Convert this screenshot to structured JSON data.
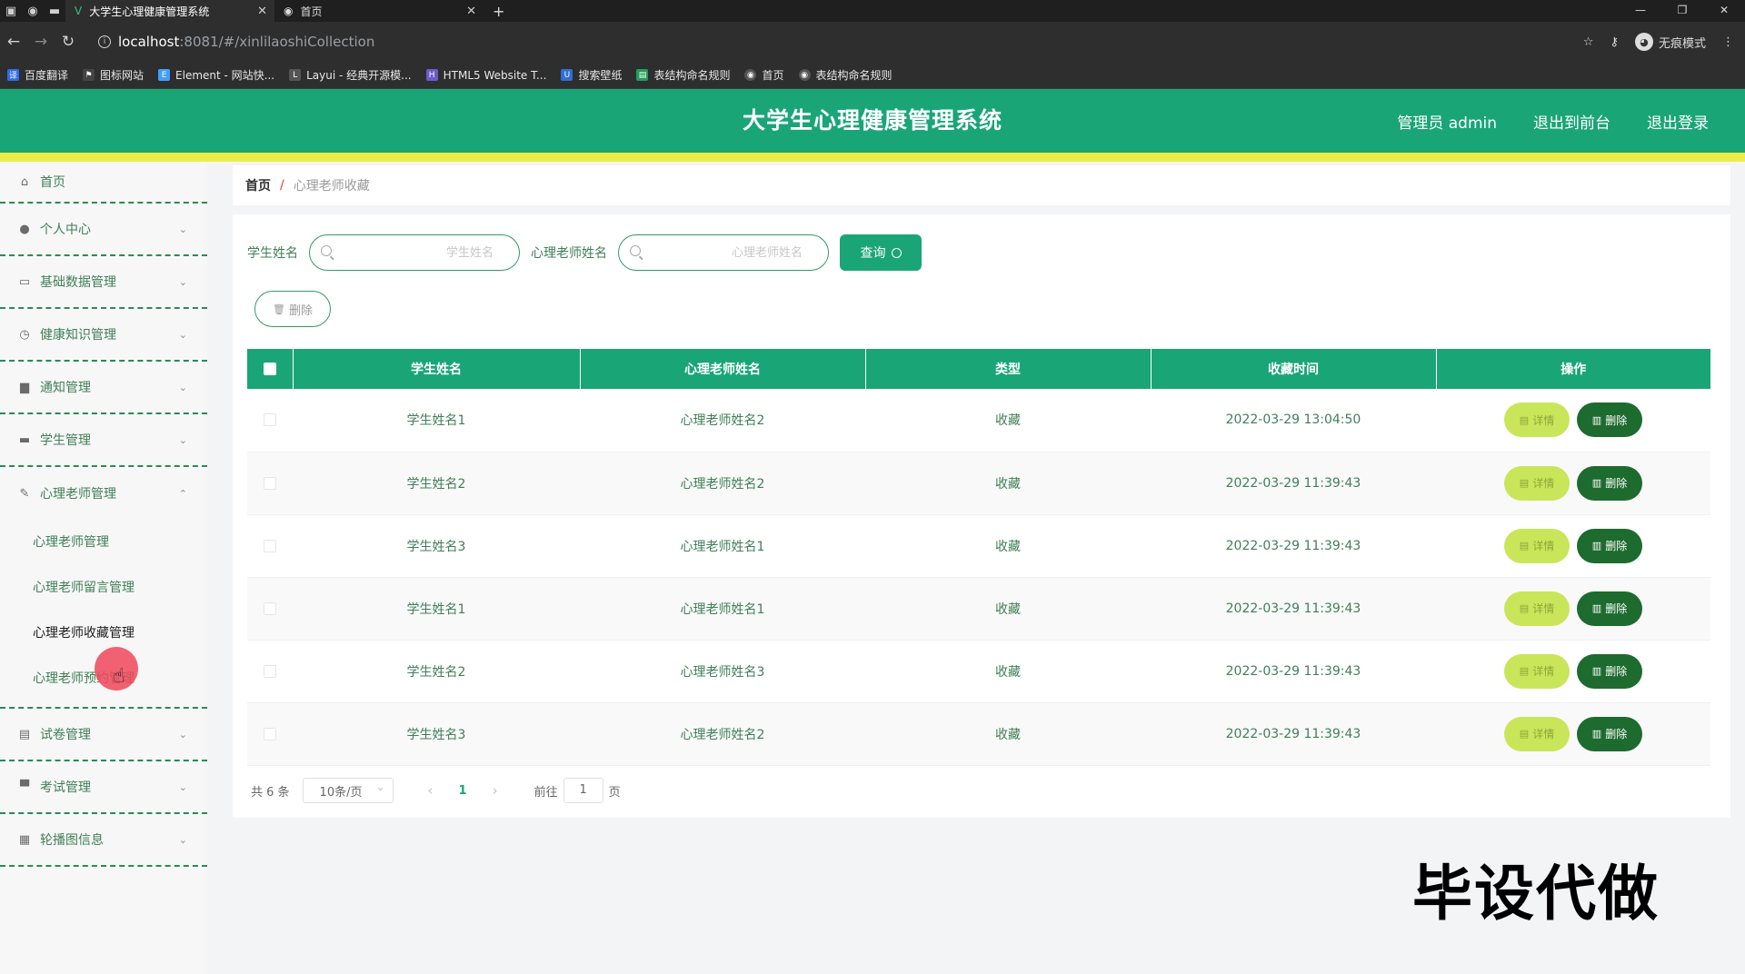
{
  "browser": {
    "tabs": [
      {
        "title": "大学生心理健康管理系统",
        "active": true
      },
      {
        "title": "首页",
        "active": false
      }
    ],
    "url_host": "localhost",
    "url_path": ":8081/#/xinlilaoshiCollection",
    "incognito_label": "无痕模式",
    "bookmarks": [
      "百度翻译",
      "图标网站",
      "Element - 网站快...",
      "Layui - 经典开源模...",
      "HTML5 Website T...",
      "搜索壁纸",
      "表结构命名规则",
      "首页",
      "表结构命名规则"
    ]
  },
  "header": {
    "title": "大学生心理健康管理系统",
    "user": "管理员 admin",
    "to_front": "退出到前台",
    "logout": "退出登录",
    "bg_color": "#1aa577",
    "accent_color": "#eded4a"
  },
  "sidebar": {
    "items": [
      {
        "label": "首页",
        "icon": "home-icon"
      },
      {
        "label": "个人中心",
        "icon": "user-icon"
      },
      {
        "label": "基础数据管理",
        "icon": "chat-icon"
      },
      {
        "label": "健康知识管理",
        "icon": "clock-icon"
      },
      {
        "label": "通知管理",
        "icon": "briefcase-icon"
      },
      {
        "label": "学生管理",
        "icon": "card-icon"
      },
      {
        "label": "心理老师管理",
        "icon": "edit-icon"
      },
      {
        "label": "试卷管理",
        "icon": "clipboard-icon"
      },
      {
        "label": "考试管理",
        "icon": "monitor-icon"
      },
      {
        "label": "轮播图信息",
        "icon": "grid-icon"
      }
    ],
    "submenu": [
      "心理老师管理",
      "心理老师留言管理",
      "心理老师收藏管理",
      "心理老师预约管理"
    ]
  },
  "breadcrumb": {
    "home": "首页",
    "current": "心理老师收藏"
  },
  "search": {
    "student_label": "学生姓名",
    "student_placeholder": "学生姓名",
    "teacher_label": "心理老师姓名",
    "teacher_placeholder": "心理老师姓名",
    "query_label": "查询"
  },
  "toolbar": {
    "delete_label": "删除"
  },
  "table": {
    "columns": [
      "学生姓名",
      "心理老师姓名",
      "类型",
      "收藏时间",
      "操作"
    ],
    "rows": [
      {
        "student": "学生姓名1",
        "teacher": "心理老师姓名2",
        "type": "收藏",
        "time": "2022-03-29 13:04:50"
      },
      {
        "student": "学生姓名2",
        "teacher": "心理老师姓名2",
        "type": "收藏",
        "time": "2022-03-29 11:39:43"
      },
      {
        "student": "学生姓名3",
        "teacher": "心理老师姓名1",
        "type": "收藏",
        "time": "2022-03-29 11:39:43"
      },
      {
        "student": "学生姓名1",
        "teacher": "心理老师姓名1",
        "type": "收藏",
        "time": "2022-03-29 11:39:43"
      },
      {
        "student": "学生姓名2",
        "teacher": "心理老师姓名3",
        "type": "收藏",
        "time": "2022-03-29 11:39:43"
      },
      {
        "student": "学生姓名3",
        "teacher": "心理老师姓名2",
        "type": "收藏",
        "time": "2022-03-29 11:39:43"
      }
    ],
    "detail_label": "详情",
    "delete_label": "删除"
  },
  "pagination": {
    "total": "共 6 条",
    "page_size": "10条/页",
    "current_page": "1",
    "goto_label": "前往",
    "goto_value": "1",
    "page_suffix": "页"
  },
  "watermark": "毕设代做"
}
